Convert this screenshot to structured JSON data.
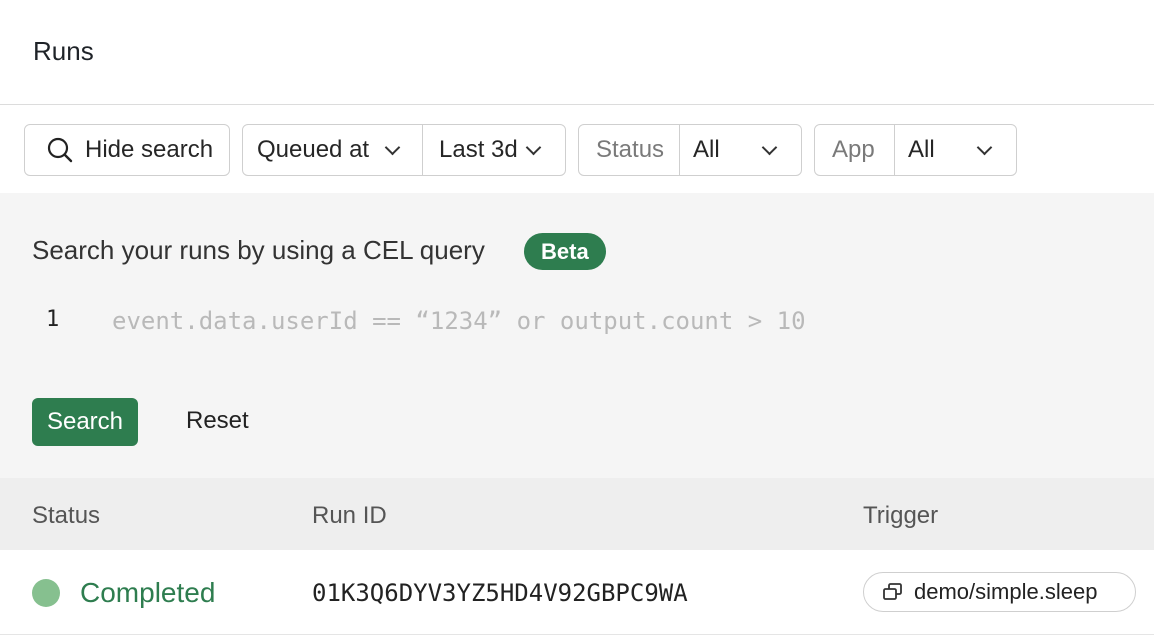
{
  "header": {
    "title": "Runs"
  },
  "filters": {
    "hide_search_label": "Hide search",
    "time_field_label": "Queued at",
    "time_range_label": "Last 3d",
    "status_label": "Status",
    "status_value": "All",
    "app_label": "App",
    "app_value": "All"
  },
  "search_panel": {
    "title": "Search your runs by using a CEL query",
    "badge": "Beta",
    "line_number": "1",
    "query_placeholder": "event.data.userId == “1234” or output.count > 10",
    "search_button": "Search",
    "reset_button": "Reset"
  },
  "table": {
    "columns": [
      "Status",
      "Run ID",
      "Trigger"
    ],
    "rows": [
      {
        "status": "Completed",
        "status_color": "#2e7d4f",
        "run_id": "01K3Q6DYV3YZ5HD4V92GBPC9WA",
        "trigger": "demo/simple.sleep"
      }
    ]
  },
  "colors": {
    "accent": "#2e7d4f",
    "status_dot_completed": "#86c08f"
  }
}
